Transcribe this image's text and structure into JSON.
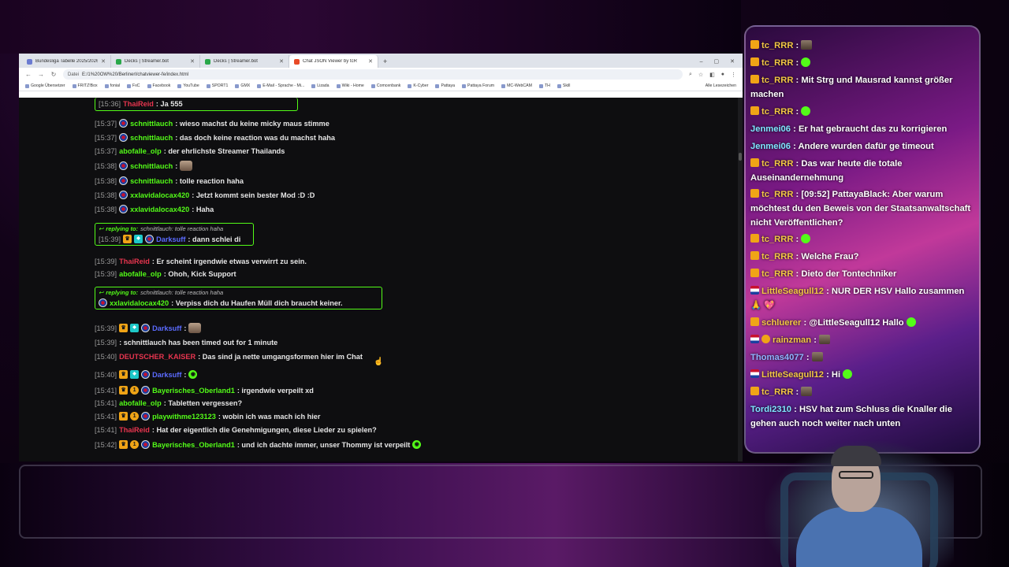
{
  "browser": {
    "tabs": [
      {
        "title": "Bundesliga Tabelle 2025/2026 ...",
        "icon": "page-icon"
      },
      {
        "title": "Decks | Streamer.bot",
        "icon": "streamerbot-icon"
      },
      {
        "title": "Decks | Streamer.bot",
        "icon": "streamerbot-icon"
      },
      {
        "title": "Chat JSON Viewer by tcR",
        "icon": "chat-icon"
      }
    ],
    "url_label": "Datei",
    "url": "E:/1%20OW%20/Berlinerl/chatviewer-fe/index.html",
    "bookmarks": [
      "Google Übersetzer",
      "FRITZ!Box",
      "fonial",
      "FxC",
      "Facebook",
      "YouTube",
      "SPORT1",
      "GMX",
      "E-Mail - Sprache - Mi...",
      "Lizada",
      "Wiki - Home",
      "Comcenbank",
      "K-Cyber",
      "Pattaya",
      "Pattaya Forum",
      "MC-WebCAM",
      "TH",
      "Skill"
    ],
    "bookmarks_right": "Alle Lesezeichen"
  },
  "chat": {
    "top_reply": {
      "ts": "[15:36]",
      "user": "ThaiReid",
      "text": ": Ja 555"
    },
    "messages": [
      {
        "ts": "[15:37]",
        "user": "schnittlauch",
        "text": ": wieso machst du keine micky maus stimme"
      },
      {
        "ts": "[15:37]",
        "user": "schnittlauch",
        "text": ": das doch keine reaction was du machst haha"
      },
      {
        "ts": "[15:37]",
        "user": "abofalle_olp",
        "text": ": der ehrlichste Streamer Thailands"
      },
      {
        "ts": "[15:38]",
        "user": "schnittlauch",
        "text": ":"
      },
      {
        "ts": "[15:38]",
        "user": "schnittlauch",
        "text": ": tolle reaction haha"
      },
      {
        "ts": "[15:38]",
        "user": "xxlavidalocax420",
        "text": ": Jetzt kommt sein bester Mod :D :D"
      },
      {
        "ts": "[15:38]",
        "user": "xxlavidalocax420",
        "text": ": Haha"
      },
      {
        "ts": "[15:39]",
        "user": "ThaiReid",
        "text": ": Er scheint irgendwie etwas verwirrt zu sein."
      },
      {
        "ts": "[15:39]",
        "user": "abofalle_olp",
        "text": ": Ohoh, Kick Support"
      },
      {
        "ts": "[15:39]",
        "user": "Darksuff",
        "text": ":"
      },
      {
        "ts": "[15:39]",
        "user": "",
        "text": ": schnittlauch has been timed out for 1 minute"
      },
      {
        "ts": "[15:40]",
        "user": "DEUTSCHER_KAISER",
        "text": ": Das sind ja nette umgangsformen hier im Chat"
      },
      {
        "ts": "[15:40]",
        "user": "Darksuff",
        "text": ":"
      },
      {
        "ts": "[15:41]",
        "user": "Bayerisches_Oberland1",
        "text": ": irgendwie verpeilt xd"
      },
      {
        "ts": "[15:41]",
        "user": "abofalle_olp",
        "text": ": Tabletten vergessen?"
      },
      {
        "ts": "[15:41]",
        "user": "playwithme123123",
        "text": ": wobin ich was mach ich hier"
      },
      {
        "ts": "[15:41]",
        "user": "ThaiReid",
        "text": ": Hat der eigentlich die Genehmigungen, diese Lieder zu spielen?"
      },
      {
        "ts": "[15:42]",
        "user": "Bayerisches_Oberland1",
        "text": ": und ich dachte immer, unser Thommy ist verpeilt"
      }
    ],
    "reply1": {
      "label": "replying to:",
      "quote": "schnittlauch: tolle reaction haha",
      "ts": "[15:39]",
      "user": "Darksuff",
      "text": ": dann schlei di"
    },
    "reply2": {
      "label": "replying to:",
      "quote": "schnittlauch: tolle reaction haha",
      "user": "xxlavidalocax420",
      "text": ": Verpiss dich du Haufen Müll dich braucht keiner."
    }
  },
  "overlay": {
    "lines": [
      {
        "user": "tc_RRR",
        "text": ":"
      },
      {
        "user": "tc_RRR",
        "text": ":"
      },
      {
        "user": "tc_RRR",
        "text": ": Mit Strg und Mausrad kannst größer machen"
      },
      {
        "user": "tc_RRR",
        "text": ":"
      },
      {
        "user": "Jenmei06",
        "text": ": Er hat gebraucht das zu korrigieren"
      },
      {
        "user": "Jenmei06",
        "text": ": Andere wurden dafür ge timeout"
      },
      {
        "user": "tc_RRR",
        "text": ": Das war heute die totale Auseinandernehmung"
      },
      {
        "user": "tc_RRR",
        "text": ": [09:52] PattayaBlack: Aber warum möchtest du den Beweis von der Staatsanwaltschaft nicht Veröffentlichen?"
      },
      {
        "user": "tc_RRR",
        "text": ":"
      },
      {
        "user": "tc_RRR",
        "text": ": Welche Frau?"
      },
      {
        "user": "tc_RRR",
        "text": ": Dieto der Tontechniker"
      },
      {
        "user": "LittleSeagull12",
        "text": ": NUR DER HSV Hallo zusammen 🙏 💖"
      },
      {
        "user": "schluerer",
        "text": ": @LittleSeagull12 Hallo"
      },
      {
        "user": "rainzman",
        "text": ":"
      },
      {
        "user": "Thomas4077",
        "text": ":"
      },
      {
        "user": "LittleSeagull12",
        "text": ": Hi"
      },
      {
        "user": "tc_RRR",
        "text": ":"
      },
      {
        "user": "Tordi2310",
        "text": ": HSV hat zum Schluss die Knaller die gehen auch noch weiter nach unten"
      }
    ]
  }
}
